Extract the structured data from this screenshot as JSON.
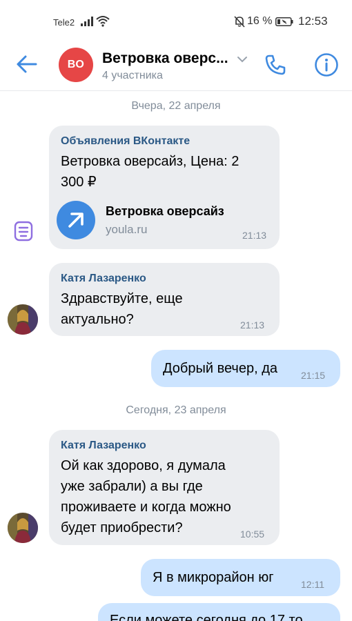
{
  "status_bar": {
    "carrier": "Tele2",
    "battery_percent": "16 %",
    "time": "12:53"
  },
  "header": {
    "avatar_initials": "ВО",
    "title": "Ветровка оверс...",
    "subtitle": "4 участника"
  },
  "messages": {
    "date_yesterday": "Вчера, 22 апреля",
    "date_today": "Сегодня, 23 апреля",
    "ad": {
      "sender": "Объявления ВКонтакте",
      "line1": "Ветровка оверсайз, Цена: 2",
      "line2": "300 ₽",
      "link_title": "Ветровка оверсайз",
      "link_domain": "youla.ru",
      "time": "21:13"
    },
    "katya1": {
      "sender": "Катя Лазаренко",
      "line1": "Здравствуйте, еще",
      "line2": "актуально?",
      "time": "21:13"
    },
    "me1": {
      "text": "Добрый вечер, да",
      "time": "21:15"
    },
    "katya2": {
      "sender": "Катя Лазаренко",
      "line1": "Ой как здорово, я думала",
      "line2": "уже забрали) а вы где",
      "line3": "проживаете и когда можно",
      "line4": "будет приобрести?",
      "time": "10:55"
    },
    "me2": {
      "text": "Я в микрорайон юг",
      "time": "12:11"
    },
    "me3": {
      "text_partial": "Если можете сегодня до 17 то"
    }
  },
  "colors": {
    "accent": "#3f8ae0",
    "incoming_bubble": "#ebedf0",
    "outgoing_bubble": "#cce4ff",
    "sender_name": "#2a5885",
    "avatar_bo": "#e64646"
  }
}
